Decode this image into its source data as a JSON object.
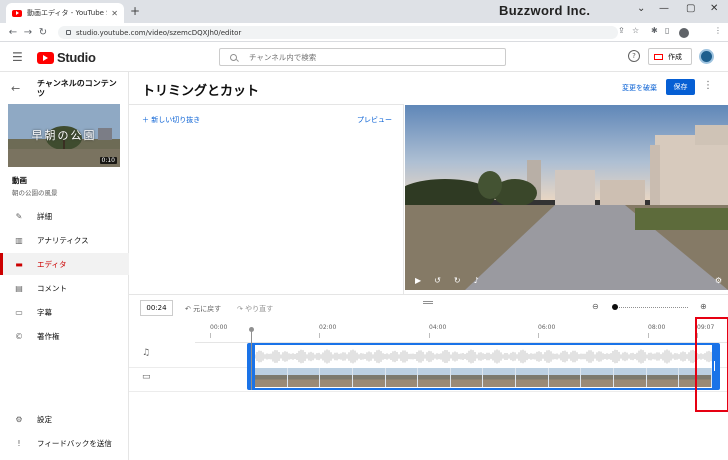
{
  "browser": {
    "tab_title": "動画エディタ - YouTube Studio",
    "brand": "Buzzword Inc.",
    "url": "studio.youtube.com/video/szemcDQXJh0/editor"
  },
  "header": {
    "logo_text": "Studio",
    "search_placeholder": "チャンネル内で検索",
    "create_label": "作成"
  },
  "sidebar": {
    "channel_title": "チャンネルのコンテンツ",
    "thumbnail_text": "早朝の公園",
    "thumbnail_duration": "0:10",
    "video_label": "動画",
    "video_subtitle": "朝の公園の風景",
    "items": [
      {
        "label": "詳細",
        "icon": "pencil-icon",
        "active": false
      },
      {
        "label": "アナリティクス",
        "icon": "analytics-icon",
        "active": false
      },
      {
        "label": "エディタ",
        "icon": "film-icon",
        "active": true
      },
      {
        "label": "コメント",
        "icon": "comment-icon",
        "active": false
      },
      {
        "label": "字幕",
        "icon": "subtitles-icon",
        "active": false
      },
      {
        "label": "著作権",
        "icon": "copyright-icon",
        "active": false
      }
    ],
    "bottom_items": [
      {
        "label": "設定",
        "icon": "gear-icon"
      },
      {
        "label": "フィードバックを送信",
        "icon": "feedback-icon"
      }
    ]
  },
  "main": {
    "title": "トリミングとカット",
    "undo_changes": "変更を破棄",
    "save_label": "保存",
    "new_cut": "新しい切り抜き",
    "preview_link": "プレビュー"
  },
  "timeline": {
    "current_time": "00:24",
    "undo_label": "元に戻す",
    "redo_label": "やり直す",
    "ticks": [
      "00:00",
      "02:00",
      "04:00",
      "06:00",
      "08:00",
      "09:07"
    ]
  },
  "colors": {
    "accent_blue": "#065fd4",
    "editor_active_red": "#cc0000",
    "youtube_red": "#ff0000",
    "highlight_box": "#e60012"
  }
}
